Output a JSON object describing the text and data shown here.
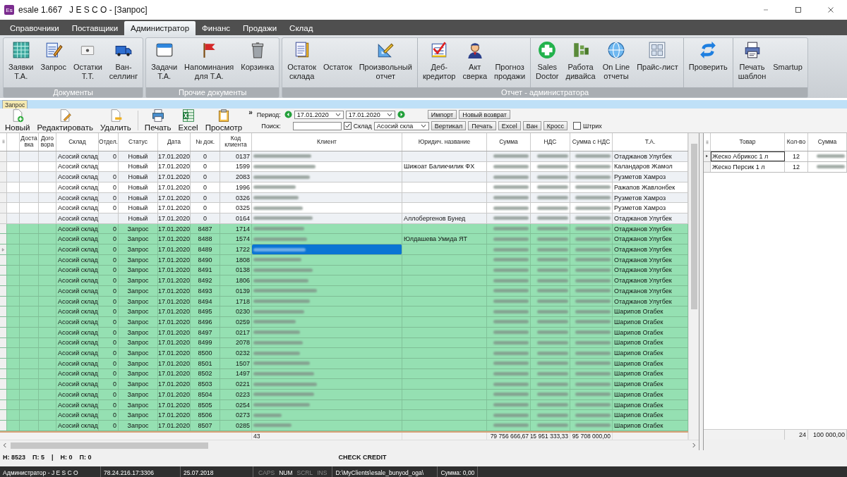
{
  "window": {
    "app_icon": "Es",
    "title": "esale 1.667   J E S C O - [Запрос]"
  },
  "menu_tabs": [
    {
      "label": "Справочники",
      "selected": false
    },
    {
      "label": "Поставщики",
      "selected": false
    },
    {
      "label": "Администратор",
      "selected": true
    },
    {
      "label": "Финанс",
      "selected": false
    },
    {
      "label": "Продажи",
      "selected": false
    },
    {
      "label": "Склад",
      "selected": false
    }
  ],
  "ribbon": {
    "groups": [
      {
        "label": "Документы",
        "sections": [
          {
            "items": [
              {
                "label": "Заявки\nТ.А."
              },
              {
                "label": "Запрос"
              },
              {
                "label": "Остатки\nТ.Т."
              },
              {
                "label": "Ван-\nселлинг"
              }
            ]
          }
        ]
      },
      {
        "label": "Прочие документы",
        "sections": [
          {
            "items": [
              {
                "label": "Задачи\nТ.А."
              },
              {
                "label": "Напоминания\nдля Т.А."
              },
              {
                "label": "Корзинка"
              }
            ]
          }
        ]
      },
      {
        "label": "Отчет - администратора",
        "sections": [
          {
            "items": [
              {
                "label": "Остаток\nсклада"
              },
              {
                "label": "Остаток"
              },
              {
                "label": "Произвольный\nотчет"
              }
            ]
          },
          {
            "items": [
              {
                "label": "Деб-\nкредитор"
              },
              {
                "label": "Акт\nсверка"
              },
              {
                "label": "Прогноз\nпродажи"
              }
            ]
          },
          {
            "items": [
              {
                "label": "Sales\nDoctor"
              },
              {
                "label": "Работа\nдивайса"
              },
              {
                "label": "On Line\nотчеты"
              },
              {
                "label": "Прайс-лист"
              }
            ]
          },
          {
            "items": [
              {
                "label": "Проверить"
              }
            ]
          },
          {
            "items": [
              {
                "label": "Печать\nшаблон"
              },
              {
                "label": "Smartup"
              }
            ]
          }
        ]
      }
    ]
  },
  "document_tabs": [
    {
      "label": "Запрос",
      "selected": true
    }
  ],
  "toolbar": {
    "buttons": [
      {
        "label": "Новый"
      },
      {
        "label": "Редактировать"
      },
      {
        "label": "Удалить"
      },
      {
        "label": "Печать"
      },
      {
        "label": "Excel"
      },
      {
        "label": "Просмотр"
      }
    ],
    "overflow": "»",
    "period_label": "Период:",
    "date_from": "17.01.2020",
    "date_to": "17.01.2020",
    "search_label": "Поиск:",
    "warehouse_filter": {
      "label": "Склад",
      "checked": true,
      "value": "Асосий скла"
    },
    "barcode_filter": {
      "label": "Штрих",
      "checked": false
    },
    "buttons_top": [
      "Импорт",
      "Новый возврат"
    ],
    "buttons_bottom": [
      "Вертикал",
      "Печать",
      "Excel",
      "Ван",
      "Кросс"
    ]
  },
  "table": {
    "columns": [
      "Доста\nвка",
      "Дого\nвора",
      "Склад",
      "Отдел.",
      "Статус",
      "Дата",
      "№ док.",
      "Код\nклиента",
      "Клиент",
      "Юридич. название",
      "Сумма",
      "НДС",
      "Сумма с НДС",
      "Т.А."
    ],
    "rows": [
      {
        "kind": "new",
        "selected": false,
        "warehouse": "Асосий склад",
        "dept": "0",
        "status": "Новый",
        "date": "17.01.2020",
        "doc_no": "0",
        "client_code": "0137",
        "agent": "Отаджанов Улугбек"
      },
      {
        "kind": "new",
        "selected": false,
        "warehouse": "Асосий склад",
        "status": "Новый",
        "date": "17.01.2020",
        "doc_no": "0",
        "client_code": "1599",
        "legal_name": "Шижоат Баликчилик ФХ",
        "agent": "Каландаров Жамол"
      },
      {
        "kind": "new",
        "selected": false,
        "warehouse": "Асосий склад",
        "dept": "0",
        "status": "Новый",
        "date": "17.01.2020",
        "doc_no": "0",
        "client_code": "2083",
        "agent": "Рузметов Хамроз"
      },
      {
        "kind": "new",
        "selected": false,
        "warehouse": "Асосий склад",
        "dept": "0",
        "status": "Новый",
        "date": "17.01.2020",
        "doc_no": "0",
        "client_code": "1996",
        "agent": "Ражапов Жавлонбек"
      },
      {
        "kind": "new",
        "selected": false,
        "warehouse": "Асосий склад",
        "dept": "0",
        "status": "Новый",
        "date": "17.01.2020",
        "doc_no": "0",
        "client_code": "0326",
        "agent": "Рузметов Хамроз"
      },
      {
        "kind": "new",
        "selected": false,
        "warehouse": "Асосий склад",
        "dept": "0",
        "status": "Новый",
        "date": "17.01.2020",
        "doc_no": "0",
        "client_code": "0325",
        "agent": "Рузметов Хамроз"
      },
      {
        "kind": "new",
        "selected": false,
        "warehouse": "Асосий склад",
        "status": "Новый",
        "date": "17.01.2020",
        "doc_no": "0",
        "client_code": "0164",
        "legal_name": "Аллобергенов Бунед",
        "agent": "Отаджанов Улугбек"
      },
      {
        "kind": "request",
        "selected": false,
        "warehouse": "Асосий склад",
        "dept": "0",
        "status": "Запрос",
        "date": "17.01.2020",
        "doc_no": "8487",
        "client_code": "1714",
        "agent": "Отаджанов Улугбек"
      },
      {
        "kind": "request",
        "selected": false,
        "warehouse": "Асосий склад",
        "dept": "0",
        "status": "Запрос",
        "date": "17.01.2020",
        "doc_no": "8488",
        "client_code": "1574",
        "legal_name": "Юлдашева Умида ЯТ",
        "agent": "Отаджанов Улугбек"
      },
      {
        "kind": "request",
        "selected": true,
        "warehouse": "Асосий склад",
        "dept": "0",
        "status": "Запрос",
        "date": "17.01.2020",
        "doc_no": "8489",
        "client_code": "1722",
        "agent": "Отаджанов Улугбек"
      },
      {
        "kind": "request",
        "selected": false,
        "warehouse": "Асосий склад",
        "dept": "0",
        "status": "Запрос",
        "date": "17.01.2020",
        "doc_no": "8490",
        "client_code": "1808",
        "agent": "Отаджанов Улугбек"
      },
      {
        "kind": "request",
        "selected": false,
        "warehouse": "Асосий склад",
        "dept": "0",
        "status": "Запрос",
        "date": "17.01.2020",
        "doc_no": "8491",
        "client_code": "0138",
        "agent": "Отаджанов Улугбек"
      },
      {
        "kind": "request",
        "selected": false,
        "warehouse": "Асосий склад",
        "dept": "0",
        "status": "Запрос",
        "date": "17.01.2020",
        "doc_no": "8492",
        "client_code": "1806",
        "agent": "Отаджанов Улугбек"
      },
      {
        "kind": "request",
        "selected": false,
        "warehouse": "Асосий склад",
        "dept": "0",
        "status": "Запрос",
        "date": "17.01.2020",
        "doc_no": "8493",
        "client_code": "0139",
        "agent": "Отаджанов Улугбек"
      },
      {
        "kind": "request",
        "selected": false,
        "warehouse": "Асосий склад",
        "dept": "0",
        "status": "Запрос",
        "date": "17.01.2020",
        "doc_no": "8494",
        "client_code": "1718",
        "agent": "Отаджанов Улугбек"
      },
      {
        "kind": "request",
        "selected": false,
        "warehouse": "Асосий склад",
        "dept": "0",
        "status": "Запрос",
        "date": "17.01.2020",
        "doc_no": "8495",
        "client_code": "0230",
        "agent": "Шарипов Огабек"
      },
      {
        "kind": "request",
        "selected": false,
        "warehouse": "Асосий склад",
        "dept": "0",
        "status": "Запрос",
        "date": "17.01.2020",
        "doc_no": "8496",
        "client_code": "0259",
        "agent": "Шарипов Огабек"
      },
      {
        "kind": "request",
        "selected": false,
        "warehouse": "Асосий склад",
        "dept": "0",
        "status": "Запрос",
        "date": "17.01.2020",
        "doc_no": "8497",
        "client_code": "0217",
        "agent": "Шарипов Огабек"
      },
      {
        "kind": "request",
        "selected": false,
        "warehouse": "Асосий склад",
        "dept": "0",
        "status": "Запрос",
        "date": "17.01.2020",
        "doc_no": "8499",
        "client_code": "2078",
        "agent": "Шарипов Огабек"
      },
      {
        "kind": "request",
        "selected": false,
        "warehouse": "Асосий склад",
        "dept": "0",
        "status": "Запрос",
        "date": "17.01.2020",
        "doc_no": "8500",
        "client_code": "0232",
        "agent": "Шарипов Огабек"
      },
      {
        "kind": "request",
        "selected": false,
        "warehouse": "Асосий склад",
        "dept": "0",
        "status": "Запрос",
        "date": "17.01.2020",
        "doc_no": "8501",
        "client_code": "1507",
        "agent": "Шарипов Огабек"
      },
      {
        "kind": "request",
        "selected": false,
        "warehouse": "Асосий склад",
        "dept": "0",
        "status": "Запрос",
        "date": "17.01.2020",
        "doc_no": "8502",
        "client_code": "1497",
        "agent": "Шарипов Огабек"
      },
      {
        "kind": "request",
        "selected": false,
        "warehouse": "Асосий склад",
        "dept": "0",
        "status": "Запрос",
        "date": "17.01.2020",
        "doc_no": "8503",
        "client_code": "0221",
        "agent": "Шарипов Огабек"
      },
      {
        "kind": "request",
        "selected": false,
        "warehouse": "Асосий склад",
        "dept": "0",
        "status": "Запрос",
        "date": "17.01.2020",
        "doc_no": "8504",
        "client_code": "0223",
        "agent": "Шарипов Огабек"
      },
      {
        "kind": "request",
        "selected": false,
        "warehouse": "Асосий склад",
        "dept": "0",
        "status": "Запрос",
        "date": "17.01.2020",
        "doc_no": "8505",
        "client_code": "0254",
        "agent": "Шарипов Огабек"
      },
      {
        "kind": "request",
        "selected": false,
        "warehouse": "Асосий склад",
        "dept": "0",
        "status": "Запрос",
        "date": "17.01.2020",
        "doc_no": "8506",
        "client_code": "0273",
        "agent": "Шарипов Огабек"
      },
      {
        "kind": "request",
        "selected": false,
        "warehouse": "Асосий склад",
        "dept": "0",
        "status": "Запрос",
        "date": "17.01.2020",
        "doc_no": "8507",
        "client_code": "0285",
        "agent": "Шарипов Огабек"
      }
    ],
    "footer": {
      "count": "43",
      "sum": "79 756 666,67",
      "vat": "15 951 333,33",
      "sum_vat": "95 708 000,00"
    }
  },
  "side_table": {
    "columns": [
      "Товар",
      "Кол-во",
      "Сумма"
    ],
    "rows": [
      {
        "selected": true,
        "product": "Жеско Абрикос 1 л",
        "qty": "12"
      },
      {
        "selected": false,
        "product": "Жеско Персик 1 л",
        "qty": "12"
      }
    ],
    "footer": {
      "qty": "24",
      "sum": "100 000,00"
    }
  },
  "status_line": {
    "items": [
      "Н: 8523",
      "П: 5",
      "|",
      "Н: 0",
      "П: 0"
    ],
    "message": "CHECK CREDIT"
  },
  "status_bar": {
    "user": "Администратор - J E S C O",
    "server": "78.24.216.17:3306",
    "date": "25.07.2018",
    "keys": [
      {
        "label": "CAPS",
        "on": false
      },
      {
        "label": "NUM",
        "on": true
      },
      {
        "label": "SCRL",
        "on": false
      },
      {
        "label": "INS",
        "on": false
      }
    ],
    "path": "D:\\MyClients\\esale_bunyod_oga\\",
    "sum": "Сумма: 0,00"
  }
}
